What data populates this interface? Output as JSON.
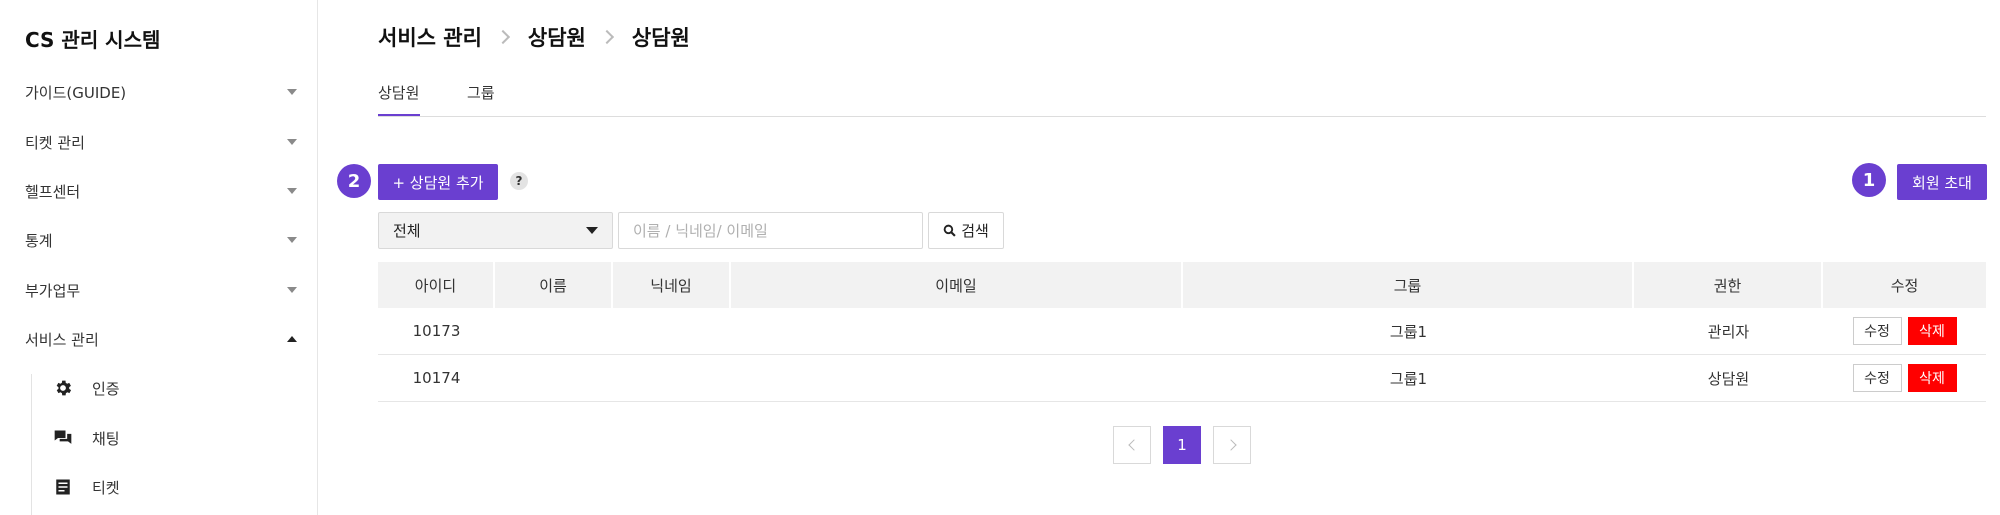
{
  "sidebar": {
    "title": "CS 관리 시스템",
    "items": [
      {
        "label": "가이드(GUIDE)"
      },
      {
        "label": "티켓 관리"
      },
      {
        "label": "헬프센터"
      },
      {
        "label": "통계"
      },
      {
        "label": "부가업무"
      },
      {
        "label": "서비스 관리"
      }
    ],
    "subitems": [
      {
        "label": "인증",
        "icon": "gear-icon"
      },
      {
        "label": "채팅",
        "icon": "chat-icon"
      },
      {
        "label": "티켓",
        "icon": "document-icon"
      }
    ]
  },
  "breadcrumb": [
    "서비스 관리",
    "상담원",
    "상담원"
  ],
  "tabs": [
    {
      "label": "상담원",
      "active": true
    },
    {
      "label": "그룹",
      "active": false
    }
  ],
  "toolbar": {
    "add_badge": "2",
    "add_label": "+ 상담원 추가",
    "help": "?",
    "invite_badge": "1",
    "invite_label": "회원 초대"
  },
  "filter": {
    "selected": "전체",
    "search_placeholder": "이름 / 닉네임/ 이메일",
    "search_label": "검색"
  },
  "table": {
    "columns": [
      "아이디",
      "이름",
      "닉네임",
      "이메일",
      "그룹",
      "권한",
      "수정"
    ],
    "rows": [
      {
        "id": "10173",
        "name": "",
        "nickname": "",
        "email": "",
        "group": "그룹1",
        "role": "관리자"
      },
      {
        "id": "10174",
        "name": "",
        "nickname": "",
        "email": "",
        "group": "그룹1",
        "role": "상담원"
      }
    ],
    "edit_label": "수정",
    "delete_label": "삭제"
  },
  "pagination": {
    "current": "1"
  },
  "colors": {
    "accent": "#6a3fd0",
    "danger": "#ff0000"
  }
}
